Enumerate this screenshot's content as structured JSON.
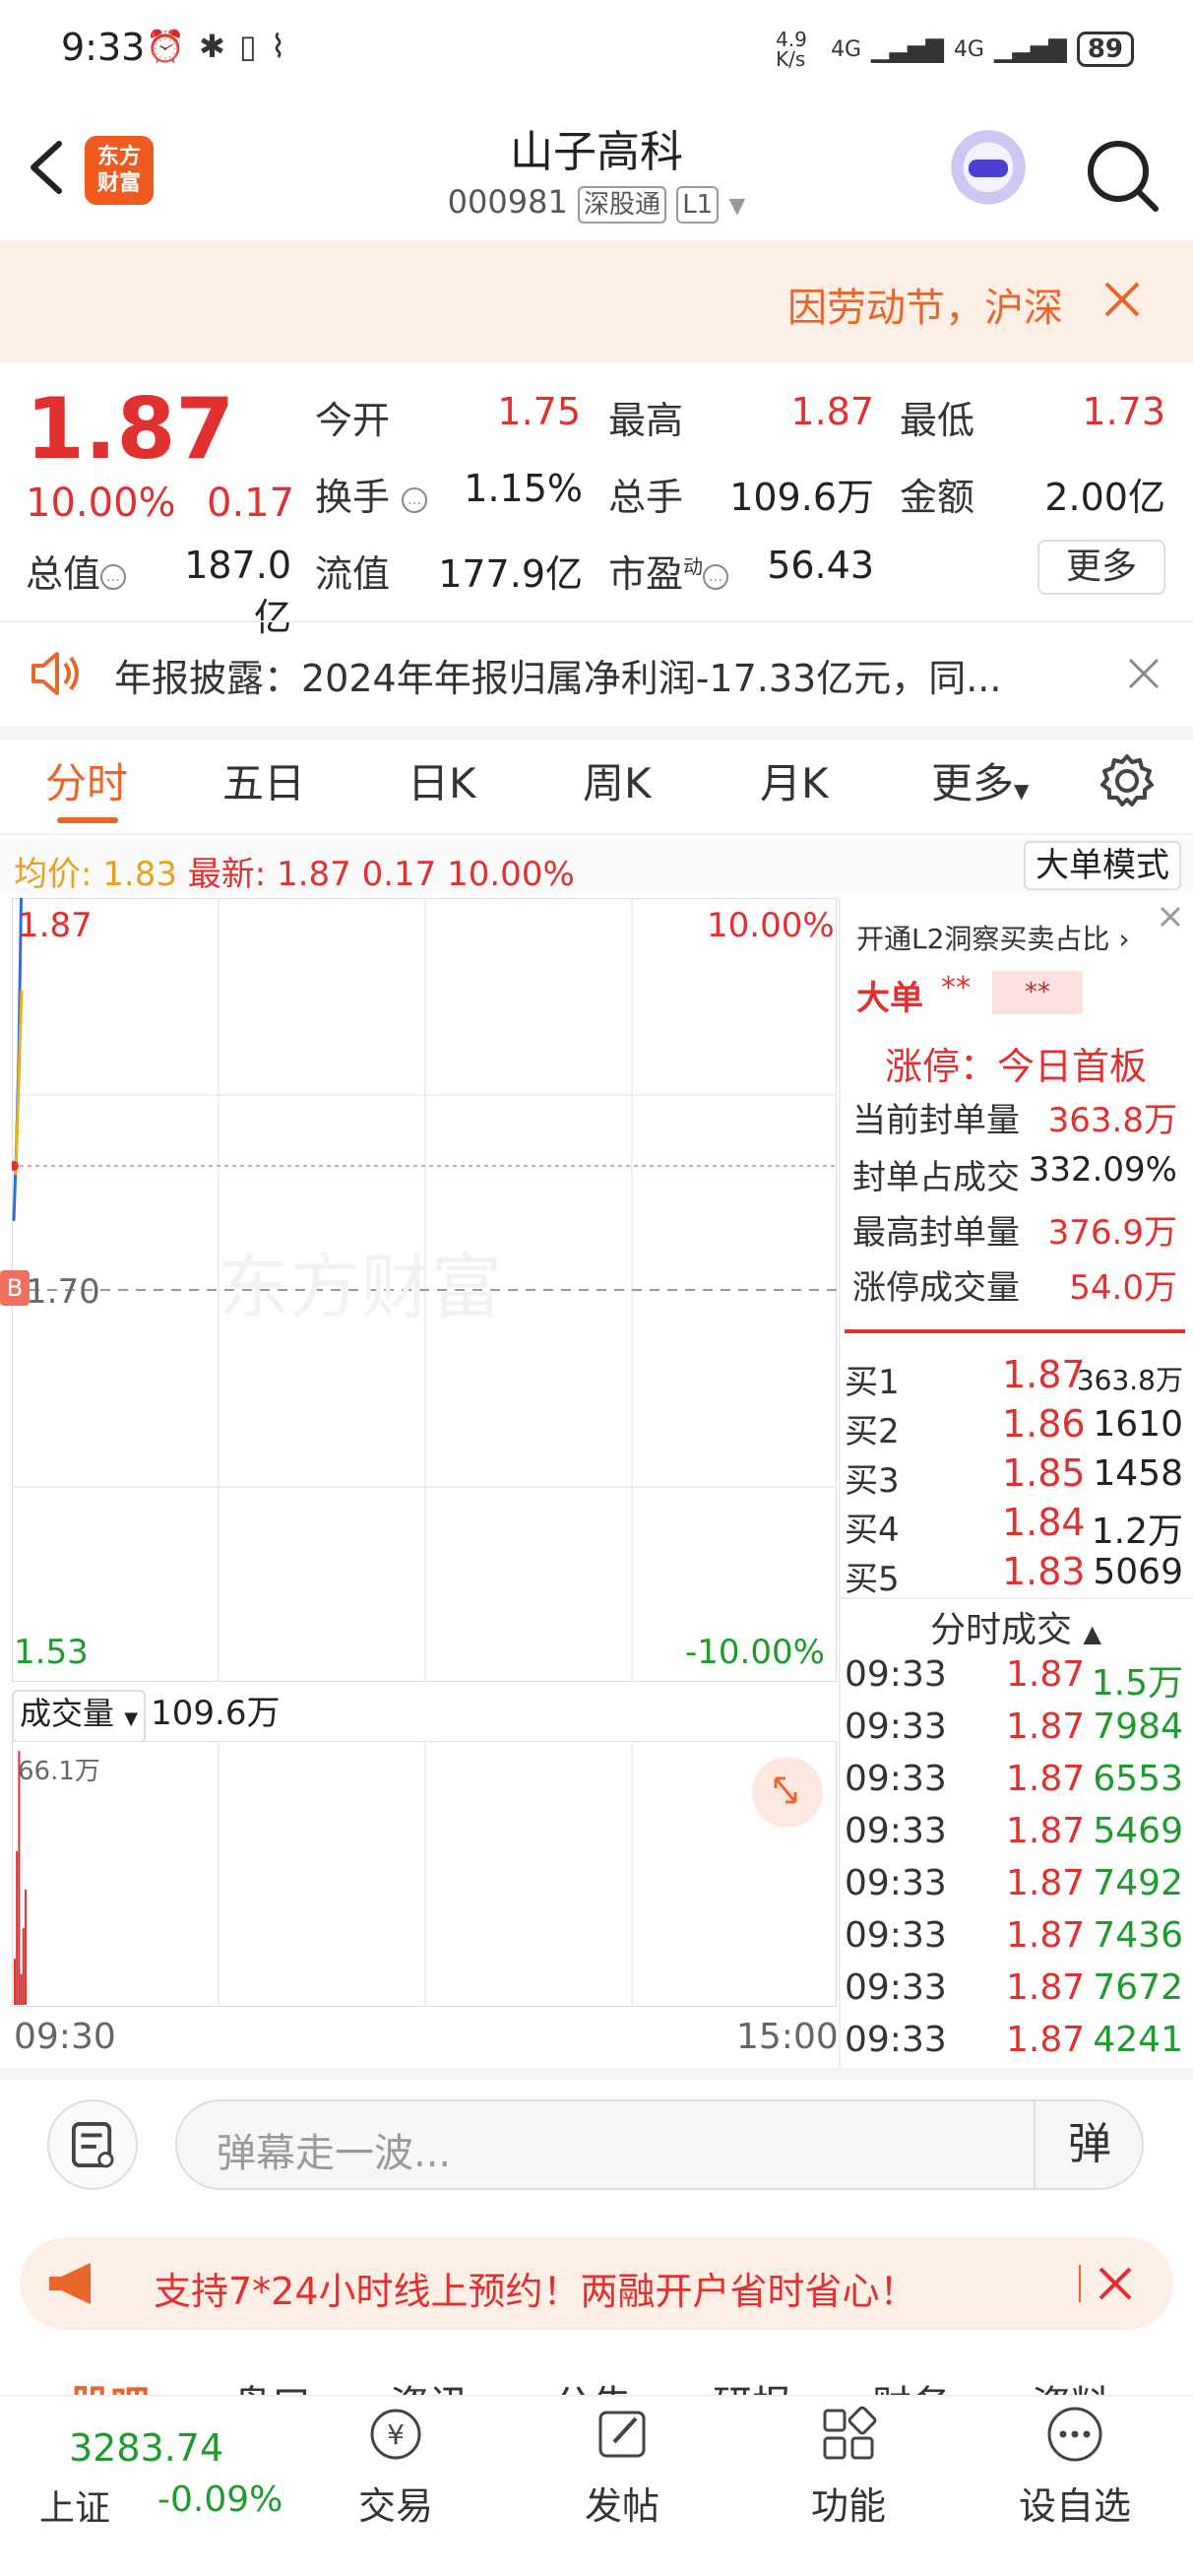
{
  "status_bar": {
    "time": "9:33",
    "net_speed": "4.9 K/s",
    "net1": "4G",
    "net2": "4G",
    "battery": "89"
  },
  "header": {
    "logo_line1": "东方",
    "logo_line2": "财富",
    "title": "山子高科",
    "code": "000981",
    "tag1": "深股通",
    "tag2": "L1"
  },
  "banner": {
    "text": "因劳动节，沪深"
  },
  "quote": {
    "price": "1.87",
    "change_pct": "10.00%",
    "change_abs": "0.17",
    "open_label": "今开",
    "open": "1.75",
    "high_label": "最高",
    "high": "1.87",
    "low_label": "最低",
    "low": "1.73",
    "turnover_label": "换手",
    "turnover": "1.15%",
    "volume_label": "总手",
    "volume": "109.6万",
    "amount_label": "金额",
    "amount": "2.00亿",
    "mcap_label": "总值",
    "mcap": "187.0亿",
    "float_label": "流值",
    "float": "177.9亿",
    "pe_label": "市盈",
    "pe_sup": "动",
    "pe": "56.43",
    "more": "更多"
  },
  "notice": {
    "text": "年报披露：2024年年报归属净利润-17.33亿元，同..."
  },
  "tabs": [
    "分时",
    "五日",
    "日K",
    "周K",
    "月K",
    "更多"
  ],
  "legend": {
    "avg_label": "均价:",
    "avg": "1.83",
    "last_label": "最新:",
    "last": "1.87",
    "chg": "0.17",
    "pct": "10.00%",
    "mode_btn": "大单模式"
  },
  "chart": {
    "top_price": "1.87",
    "top_pct": "10.00%",
    "mid_price": "1.70",
    "bottom_price": "1.53",
    "bottom_pct": "-10.00%",
    "watermark": "东方财富",
    "marker": "B",
    "vol_select": "成交量",
    "vol_total": "109.6万",
    "vol_max": "66.1万",
    "time_start": "09:30",
    "time_end": "15:00"
  },
  "chart_data": {
    "type": "line",
    "series": [
      {
        "values": [
          1.73,
          1.76,
          1.8,
          1.87
        ]
      }
    ],
    "avg_series": {
      "values": [
        1.75,
        1.79,
        1.83
      ]
    },
    "ylim": [
      1.53,
      1.87
    ],
    "volume": [
      12,
      40,
      66.1,
      8,
      20,
      30
    ]
  },
  "panel": {
    "head": "开通L2洞察买卖占比",
    "big": "大单",
    "star1": "**",
    "star2": "**",
    "zt": "涨停：今日首板",
    "stats": [
      {
        "label": "当前封单量",
        "value": "363.8万"
      },
      {
        "label": "封单占成交",
        "value": "332.09%"
      },
      {
        "label": "最高封单量",
        "value": "376.9万"
      },
      {
        "label": "涨停成交量",
        "value": "54.0万"
      }
    ],
    "orderbook": [
      {
        "label": "买1",
        "price": "1.87",
        "vol": "363.8万"
      },
      {
        "label": "买2",
        "price": "1.86",
        "vol": "1610"
      },
      {
        "label": "买3",
        "price": "1.85",
        "vol": "1458"
      },
      {
        "label": "买4",
        "price": "1.84",
        "vol": "1.2万"
      },
      {
        "label": "买5",
        "price": "1.83",
        "vol": "5069"
      }
    ],
    "ticks_head": "分时成交",
    "ticks": [
      {
        "time": "09:33",
        "price": "1.87",
        "vol": "1.5万"
      },
      {
        "time": "09:33",
        "price": "1.87",
        "vol": "7984"
      },
      {
        "time": "09:33",
        "price": "1.87",
        "vol": "6553"
      },
      {
        "time": "09:33",
        "price": "1.87",
        "vol": "5469"
      },
      {
        "time": "09:33",
        "price": "1.87",
        "vol": "7492"
      },
      {
        "time": "09:33",
        "price": "1.87",
        "vol": "7436"
      },
      {
        "time": "09:33",
        "price": "1.87",
        "vol": "7672"
      },
      {
        "time": "09:33",
        "price": "1.87",
        "vol": "4241"
      }
    ]
  },
  "danmaku": {
    "placeholder": "弹幕走一波...",
    "btn": "弹"
  },
  "ad": {
    "text": "支持7*24小时线上预约！两融开户省时省心！"
  },
  "section_tabs": [
    "股吧",
    "盘口",
    "资讯",
    "公告",
    "研报",
    "财务",
    "资料"
  ],
  "bottom": {
    "index_value": "3283.74",
    "index_name": "上证",
    "index_chg": "-0.09%",
    "items": [
      "交易",
      "发帖",
      "功能",
      "设自选"
    ]
  }
}
